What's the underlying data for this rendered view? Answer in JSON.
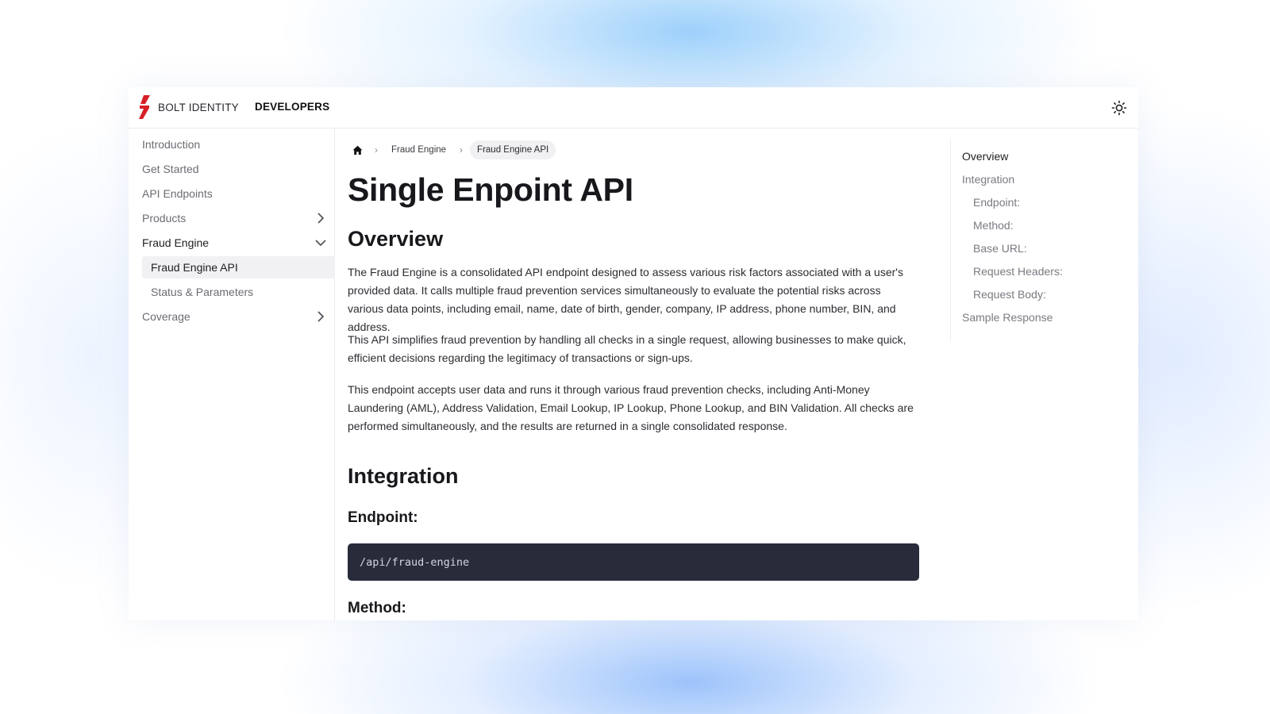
{
  "header": {
    "brand": "BOLT IDENTITY",
    "nav_link": "DEVELOPERS",
    "logo_color": "#d72027",
    "theme_icon": "sun-icon"
  },
  "sidebar": {
    "items": [
      {
        "label": "Introduction"
      },
      {
        "label": "Get Started"
      },
      {
        "label": "API Endpoints"
      },
      {
        "label": "Products",
        "chevron": "chevron-right-icon"
      },
      {
        "label": "Fraud Engine",
        "chevron": "chevron-down-icon",
        "expanded": true
      },
      {
        "label": "Coverage",
        "chevron": "chevron-right-icon"
      }
    ],
    "fraud_engine_children": [
      {
        "label": "Fraud Engine API",
        "selected": true
      },
      {
        "label": "Status & Parameters"
      }
    ]
  },
  "breadcrumb": {
    "home_icon": "home-icon",
    "items": [
      "Fraud Engine",
      "Fraud Engine API"
    ]
  },
  "main": {
    "title": "Single Enpoint API",
    "overview_heading": "Overview",
    "paragraphs": [
      "The Fraud Engine is a consolidated API endpoint designed to assess various risk factors associated with a user's provided data. It calls multiple fraud prevention services simultaneously to evaluate the potential risks across various data points, including email, name, date of birth, gender, company, IP address, phone number, BIN, and address.",
      "This API simplifies fraud prevention by handling all checks in a single request, allowing businesses to make quick, efficient decisions regarding the legitimacy of transactions or sign-ups.",
      "This endpoint accepts user data and runs it through various fraud prevention checks, including Anti-Money Laundering (AML), Address Validation, Email Lookup, IP Lookup, Phone Lookup, and BIN Validation. All checks are performed simultaneously, and the results are returned in a single consolidated response."
    ],
    "integration_heading": "Integration",
    "endpoint_heading": "Endpoint:",
    "endpoint_code": "/api/fraud-engine",
    "method_heading": "Method:"
  },
  "toc": {
    "items": [
      {
        "label": "Overview",
        "active": true
      },
      {
        "label": "Integration"
      },
      {
        "label": "Endpoint:"
      },
      {
        "label": "Method:"
      },
      {
        "label": "Base URL:"
      },
      {
        "label": "Request Headers:"
      },
      {
        "label": "Request Body:"
      },
      {
        "label": "Sample Response"
      }
    ]
  }
}
